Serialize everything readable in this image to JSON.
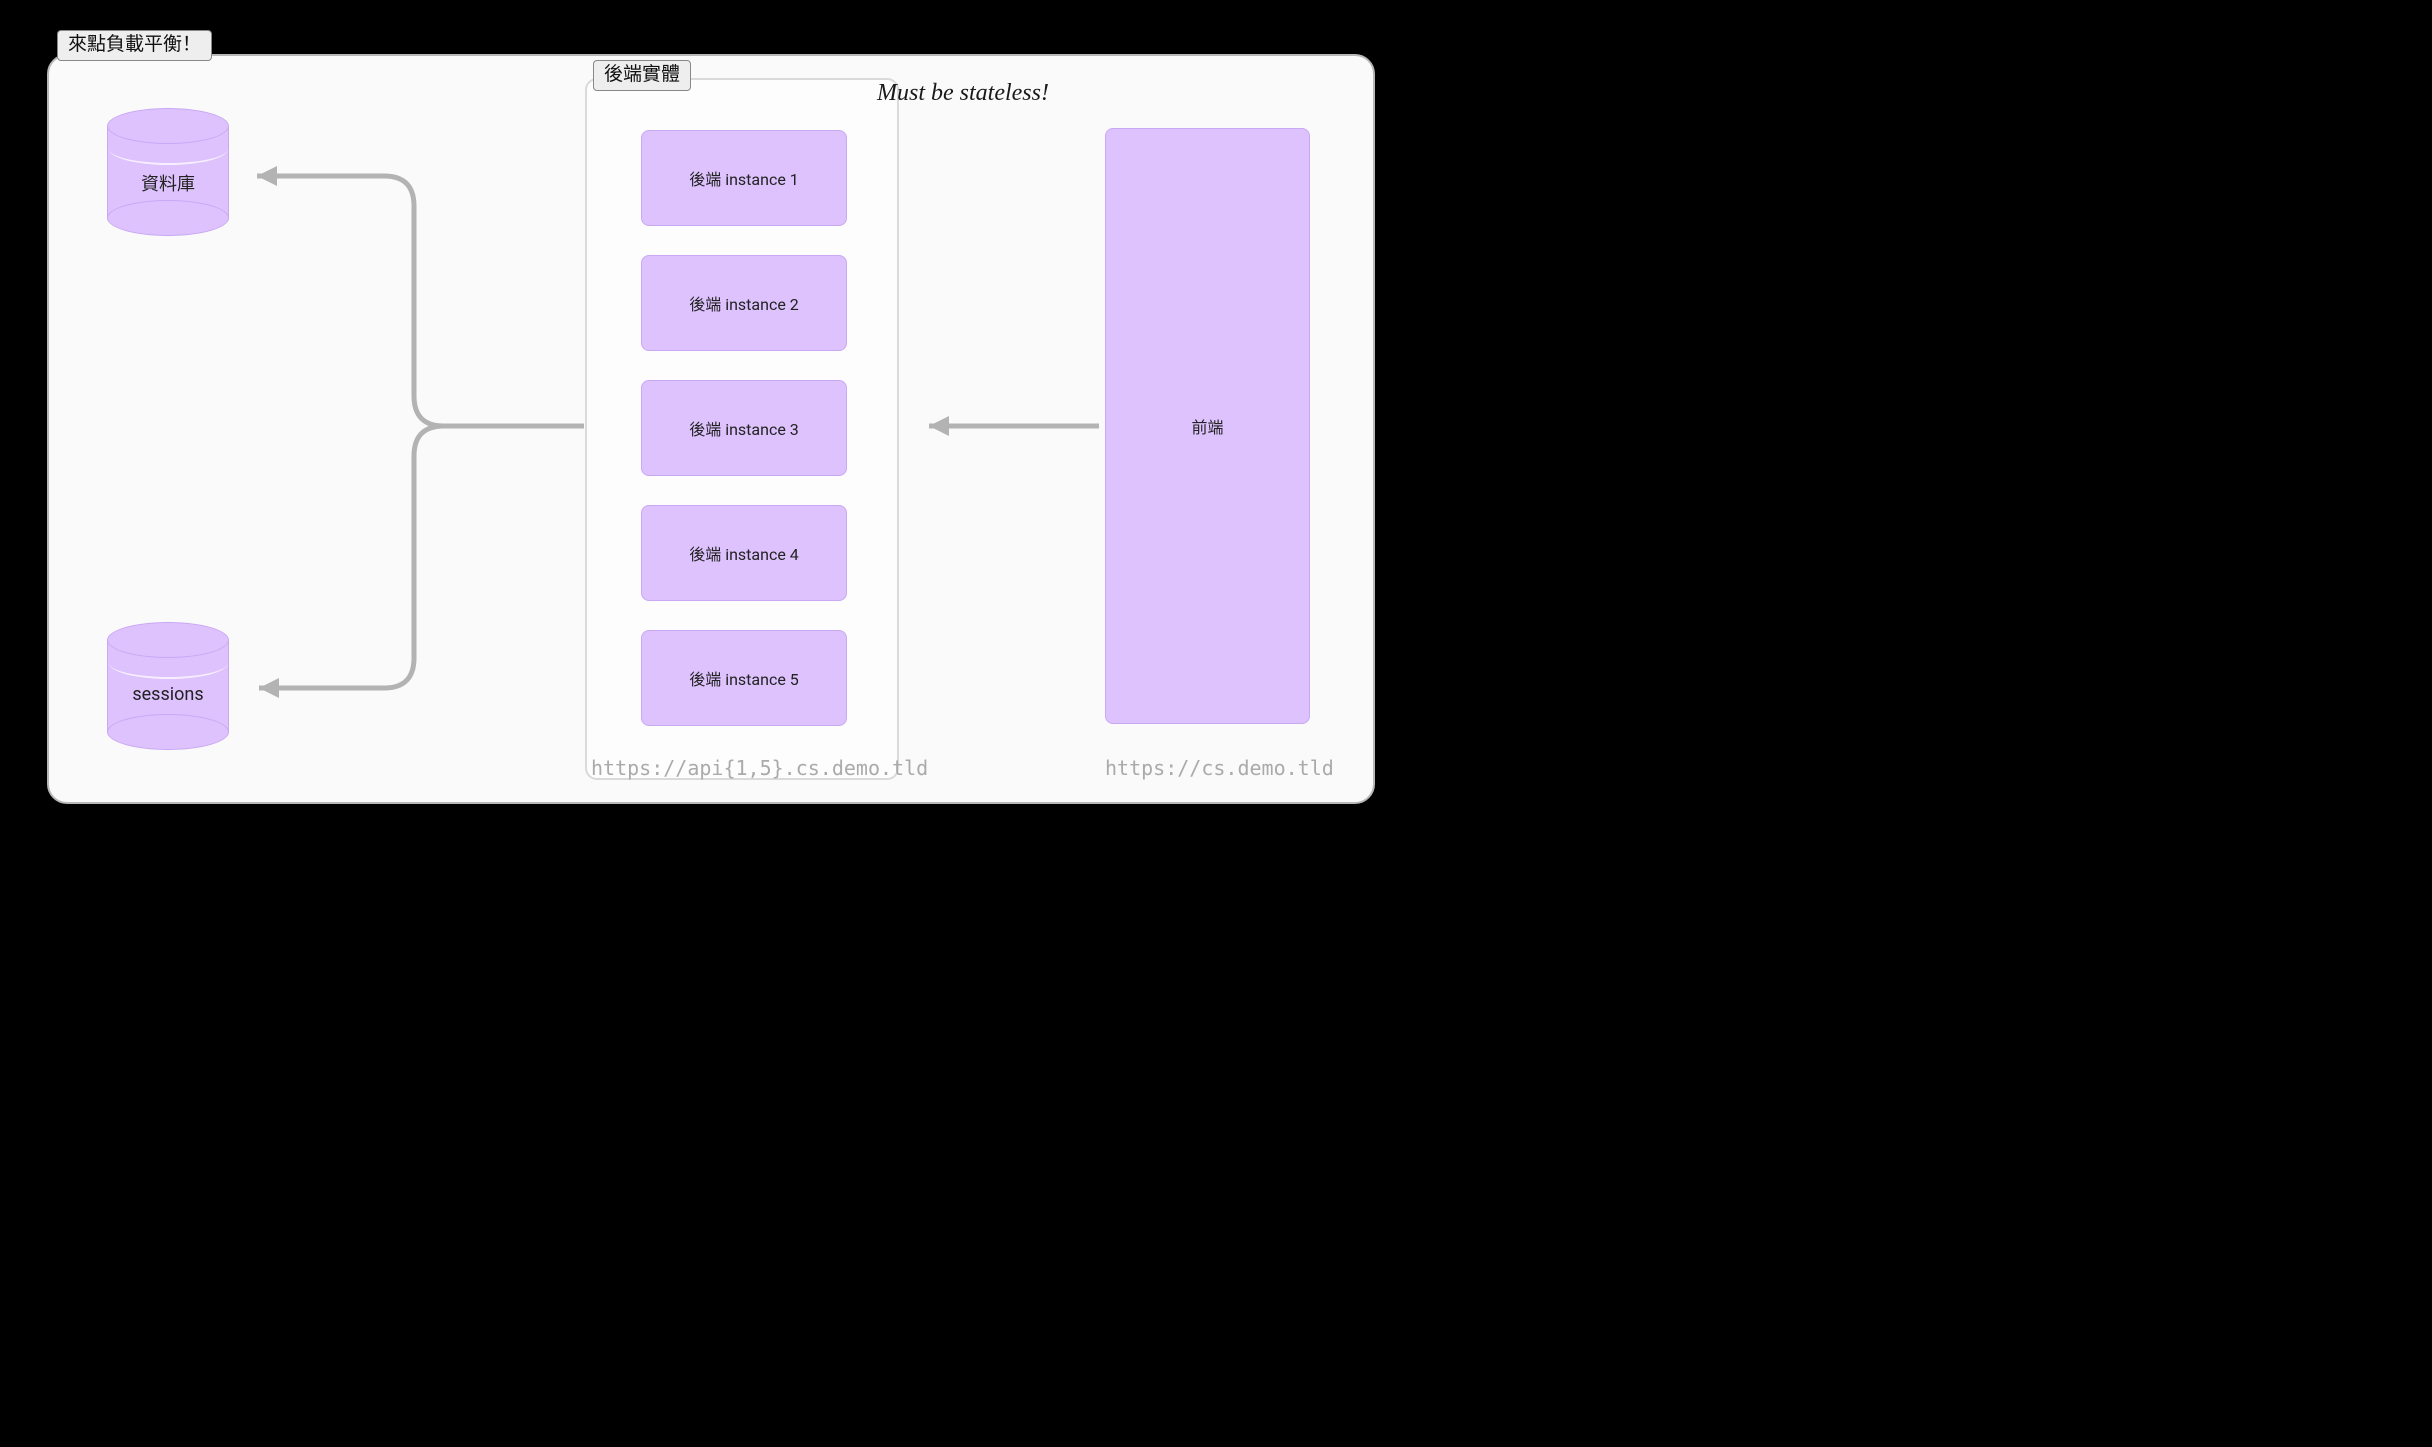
{
  "title": "來點負載平衡！",
  "backend_group_label": "後端實體",
  "instances": [
    "後端 instance 1",
    "後端 instance 2",
    "後端 instance 3",
    "後端 instance 4",
    "後端 instance 5"
  ],
  "frontend_label": "前端",
  "databases": {
    "db1": "資料庫",
    "db2": "sessions"
  },
  "urls": {
    "backend": "https://api{1,5}.cs.demo.tld",
    "frontend": "https://cs.demo.tld"
  },
  "annotation": "Must be stateless!",
  "colors": {
    "node_fill": "#dec2fd",
    "node_border": "#c9a8f5",
    "arrow": "#b3b3b3",
    "frame_bg": "#fafafa"
  }
}
